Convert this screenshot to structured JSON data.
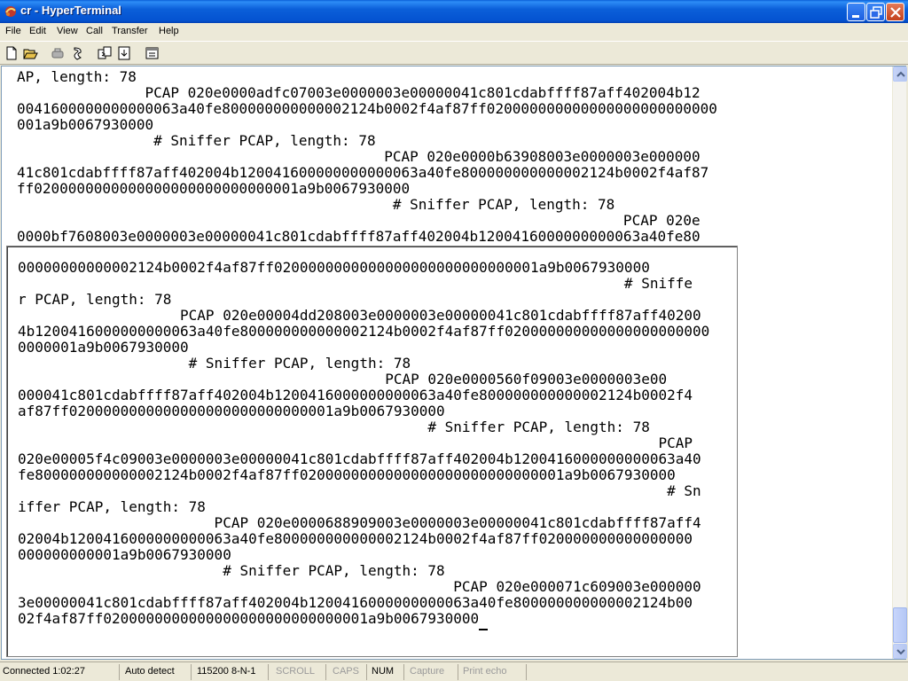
{
  "window": {
    "title": "cr - HyperTerminal"
  },
  "menu": {
    "items": [
      "File",
      "Edit",
      "View",
      "Call",
      "Transfer",
      "Help"
    ]
  },
  "toolbar": {
    "icons": [
      "new-icon",
      "open-icon",
      "disconnect-icon",
      "call-icon",
      "send-icon",
      "receive-icon",
      "properties-icon"
    ]
  },
  "terminal": {
    "scrollback_lines": [
      "AP, length: 78",
      "               PCAP 020e0000adfc07003e0000003e00000041c801cdabffff87aff402004b12",
      "0041600000000000063a40fe800000000000002124b0002f4af87ff020000000000000000000000000",
      "001a9b0067930000",
      "                # Sniffer PCAP, length: 78",
      "                                           PCAP 020e0000b63908003e0000003e000000",
      "41c801cdabffff87aff402004b120041600000000000063a40fe800000000000002124b0002f4af87",
      "ff0200000000000000000000000000001a9b0067930000",
      "                                            # Sniffer PCAP, length: 78",
      "                                                                       PCAP 020e",
      "0000bf7608003e0000003e00000041c801cdabffff87aff402004b1200416000000000063a40fe80"
    ],
    "active_lines": [
      "00000000000002124b0002f4af87ff0200000000000000000000000000001a9b0067930000",
      "                                                                       # Sniffe",
      "r PCAP, length: 78",
      "                   PCAP 020e00004dd208003e0000003e00000041c801cdabffff87aff40200",
      "4b1200416000000000063a40fe800000000000002124b0002f4af87ff020000000000000000000000",
      "0000001a9b0067930000",
      "                    # Sniffer PCAP, length: 78",
      "                                           PCAP 020e0000560f09003e0000003e00",
      "000041c801cdabffff87aff402004b1200416000000000063a40fe800000000000002124b0002f4",
      "af87ff0200000000000000000000000000001a9b0067930000",
      "                                                # Sniffer PCAP, length: 78",
      "                                                                           PCAP",
      "020e00005f4c09003e0000003e00000041c801cdabffff87aff402004b1200416000000000063a40",
      "fe800000000000002124b0002f4af87ff0200000000000000000000000000001a9b0067930000",
      "                                                                            # Sn",
      "iffer PCAP, length: 78",
      "                       PCAP 020e0000688909003e0000003e00000041c801cdabffff87aff4",
      "02004b1200416000000000063a40fe800000000000002124b0002f4af87ff020000000000000000",
      "000000000001a9b0067930000",
      "                        # Sniffer PCAP, length: 78",
      "                                                   PCAP 020e000071c609003e000000",
      "3e00000041c801cdabffff87aff402004b1200416000000000063a40fe800000000000002124b00",
      "02f4af87ff0200000000000000000000000000001a9b0067930000"
    ]
  },
  "statusbar": {
    "connected": "Connected 1:02:27",
    "detect": "Auto detect",
    "settings": "115200 8-N-1",
    "scroll": "SCROLL",
    "caps": "CAPS",
    "num": "NUM",
    "capture": "Capture",
    "print_echo": "Print echo"
  },
  "colors": {
    "titlebar": "#0453d1",
    "chrome": "#ece9d8",
    "terminal_bg": "#ffffff"
  }
}
